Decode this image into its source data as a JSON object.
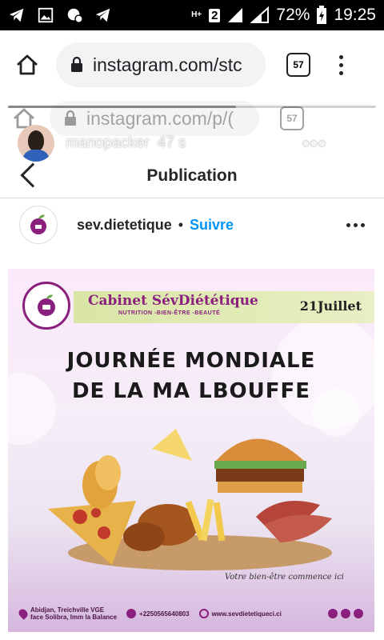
{
  "status_bar": {
    "battery": "72%",
    "time": "19:25",
    "network_badge": "H+",
    "sim_slot": "2"
  },
  "browser": {
    "url": "instagram.com/stc",
    "tab_count": "57"
  },
  "story_overlay": {
    "ghost_url": "instagram.com/p/(",
    "ghost_tab_count": "57",
    "username": "manopacker",
    "time_ago": "47 s",
    "more": "•••",
    "progress": 0.62
  },
  "instagram": {
    "page_title": "Publication",
    "post": {
      "username": "sev.dietetique",
      "separator": "•",
      "follow_label": "Suivre",
      "poster": {
        "cabinet_name": "Cabinet SévDiététique",
        "tagline": "NUTRITION -BIEN-ÊTRE -BEAUTÉ",
        "date": "21Juillet",
        "headline_line1": "JOURNÉE MONDIALE",
        "headline_line2": "DE LA MA LBOUFFE",
        "slogan": "Votre bien-être commence ici",
        "address_line1": "Abidjan, Treichville VGE",
        "address_line2": "face Solibra, Imm la Balance",
        "phone": "+2250565640803",
        "website": "www.sevdietetiqueci.ci"
      }
    }
  },
  "colors": {
    "brand_purple": "#8a1f7e",
    "follow_blue": "#0095f6",
    "status_bar_bg": "#000000"
  }
}
